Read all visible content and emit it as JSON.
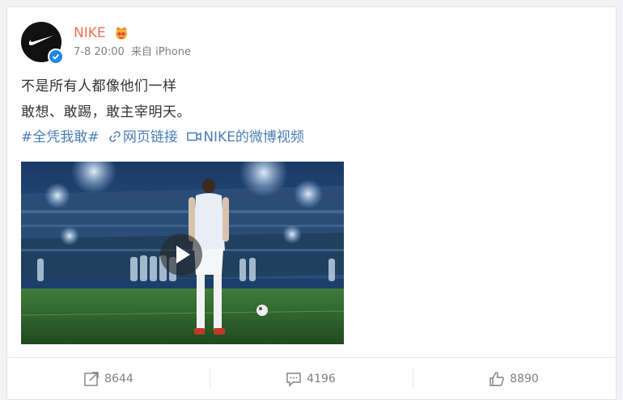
{
  "post": {
    "author": "NIKE",
    "timestamp": "7-8 20:00",
    "source": "来自 iPhone",
    "text_line_1": "不是所有人都像他们一样",
    "text_line_2": "敢想、敢踢，敢主宰明天。",
    "hashtag": "#全凭我敢#",
    "web_link": "网页链接",
    "video_link": "NIKE的微博视频"
  },
  "actions": {
    "repost_count": "8644",
    "comment_count": "4196",
    "like_count": "8890"
  },
  "colors": {
    "username": "#eb7350",
    "link": "#4a7db8",
    "verified": "#1e88e5"
  },
  "icons": [
    "nike-swoosh-icon",
    "verified-icon",
    "vip-crown-icon",
    "link-icon",
    "video-icon",
    "play-icon",
    "repost-icon",
    "comment-icon",
    "like-icon"
  ]
}
